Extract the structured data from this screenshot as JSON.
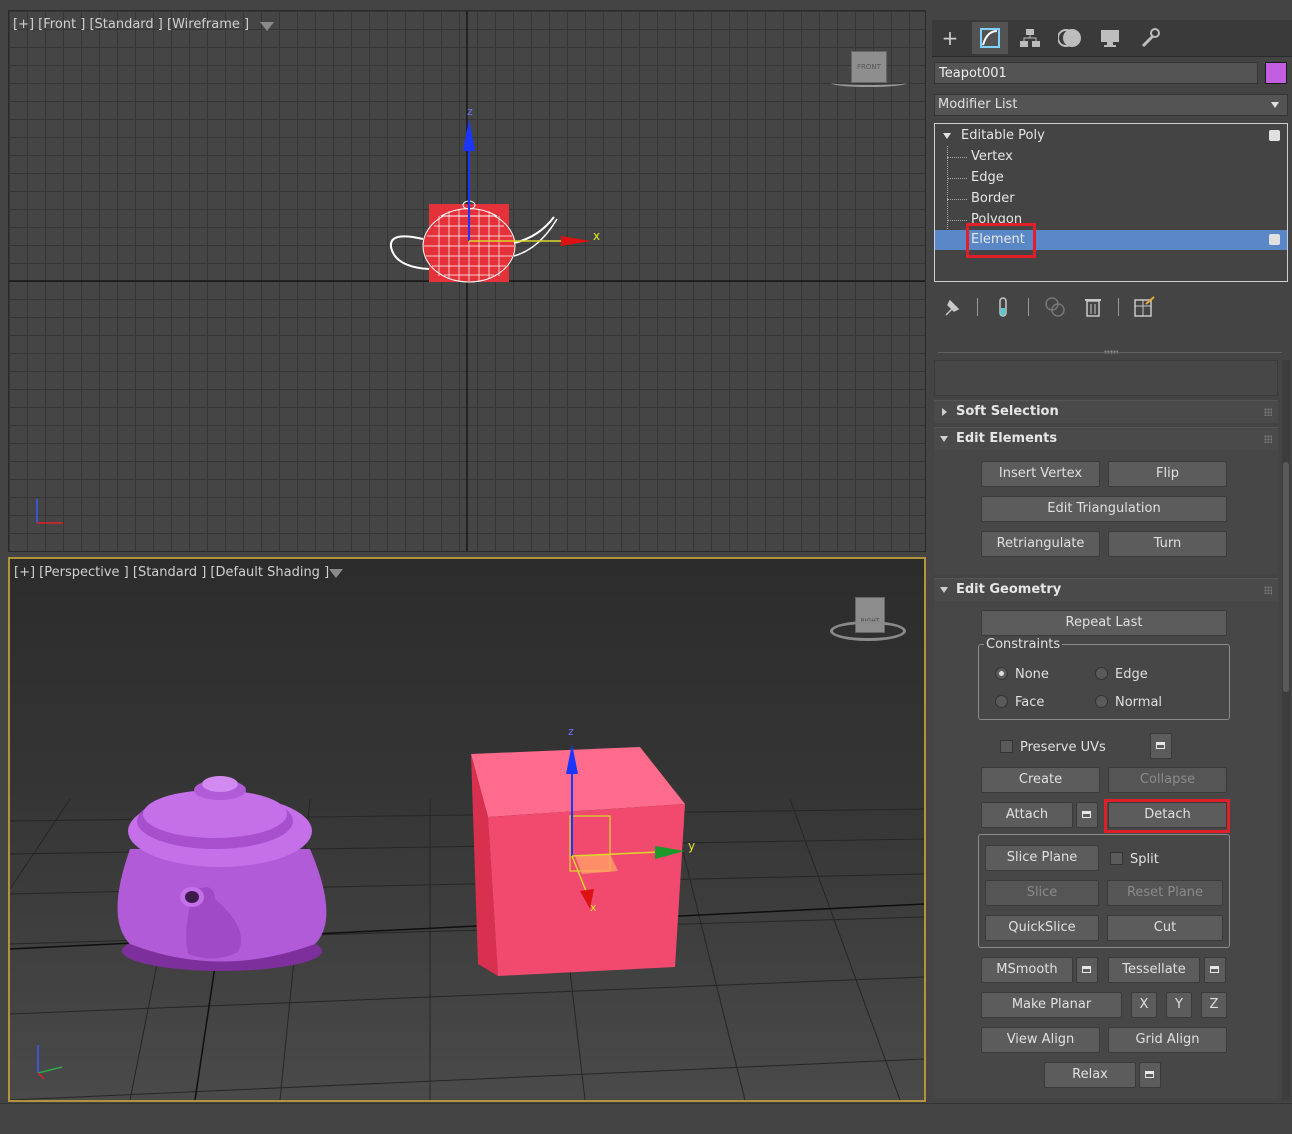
{
  "viewports": {
    "front": {
      "label": "[+] [Front ] [Standard ] [Wireframe ]",
      "viewcube_label": "FRONT",
      "axis_x": "x",
      "axis_z": "z"
    },
    "perspective": {
      "label": "[+] [Perspective ] [Standard ] [Default Shading ]",
      "viewcube_label": "RIGHT",
      "axis_x": "x",
      "axis_y": "y",
      "axis_z": "z"
    }
  },
  "command_panel": {
    "tabs": [
      "create-icon",
      "modify-icon",
      "hierarchy-icon",
      "motion-icon",
      "display-icon",
      "utilities-icon"
    ],
    "object_name": "Teapot001",
    "object_color": "#c15fe0",
    "modifier_list": "Modifier List",
    "stack": {
      "root": "Editable Poly",
      "items": [
        "Vertex",
        "Edge",
        "Border",
        "Polygon",
        "Element"
      ],
      "selected": "Element"
    }
  },
  "rollouts": {
    "soft_selection": "Soft Selection",
    "edit_elements": {
      "title": "Edit Elements",
      "insert_vertex": "Insert Vertex",
      "flip": "Flip",
      "edit_triangulation": "Edit Triangulation",
      "retriangulate": "Retriangulate",
      "turn": "Turn"
    },
    "edit_geometry": {
      "title": "Edit Geometry",
      "repeat_last": "Repeat Last",
      "constraints": {
        "label": "Constraints",
        "none": "None",
        "edge": "Edge",
        "face": "Face",
        "normal": "Normal",
        "selected": "None"
      },
      "preserve_uvs": "Preserve UVs",
      "create": "Create",
      "collapse": "Collapse",
      "attach": "Attach",
      "detach": "Detach",
      "slice_plane": "Slice Plane",
      "split": "Split",
      "slice": "Slice",
      "reset_plane": "Reset Plane",
      "quickslice": "QuickSlice",
      "cut": "Cut",
      "msmooth": "MSmooth",
      "tessellate": "Tessellate",
      "make_planar": "Make Planar",
      "x": "X",
      "y": "Y",
      "z": "Z",
      "view_align": "View Align",
      "grid_align": "Grid Align",
      "relax": "Relax"
    }
  },
  "colors": {
    "highlight_box": "#e01f2a",
    "selection": "#5a87c7",
    "active_viewport_border": "#b3943b",
    "teapot": "#c15fe0",
    "box": "#f2496e"
  }
}
